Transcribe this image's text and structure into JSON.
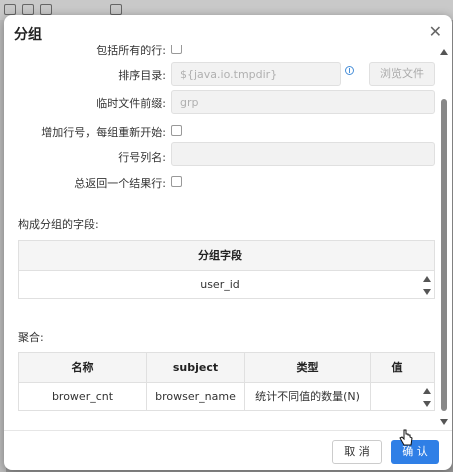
{
  "dialog": {
    "title": "分组",
    "close_symbol": "✕"
  },
  "form": {
    "include_all_rows_label": "包括所有的行:",
    "sort_dir_label": "排序目录:",
    "sort_dir_value": "${java.io.tmpdir}",
    "browse_label": "浏览文件",
    "temp_prefix_label": "临时文件前缀:",
    "temp_prefix_value": "grp",
    "add_line_number_label": "增加行号，每组重新开始:",
    "line_number_column_label": "行号列名:",
    "line_number_column_value": "",
    "always_one_row_label": "总返回一个结果行:"
  },
  "group_fields": {
    "section_label": "构成分组的字段:",
    "header": "分组字段",
    "rows": [
      "user_id"
    ]
  },
  "aggregates": {
    "section_label": "聚合:",
    "headers": [
      "名称",
      "subject",
      "类型",
      "值"
    ],
    "rows": [
      [
        "brower_cnt",
        "browser_name",
        "统计不同值的数量(N)",
        ""
      ]
    ]
  },
  "footer": {
    "cancel_label": "取 消",
    "ok_label": "确 认"
  }
}
